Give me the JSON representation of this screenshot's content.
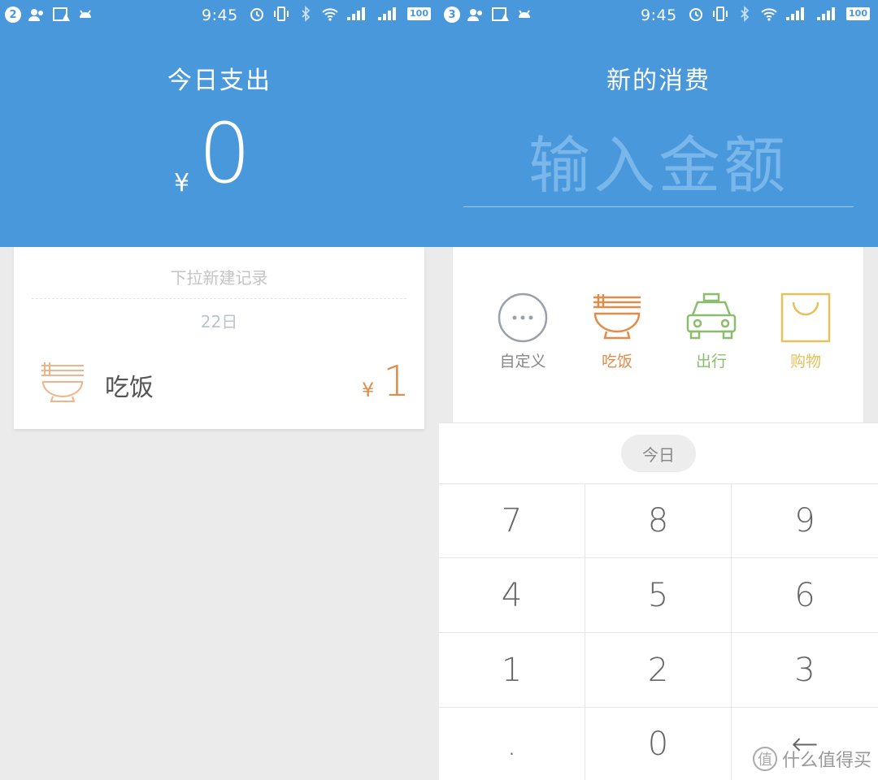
{
  "left": {
    "status": {
      "badge": "2",
      "time": "9:45",
      "battery": "100"
    },
    "header": {
      "title": "今日支出",
      "currency": "¥",
      "amount": "0"
    },
    "list": {
      "pull_hint": "下拉新建记录",
      "date": "22日",
      "record": {
        "name": "吃饭",
        "currency": "¥",
        "amount": "1",
        "icon": "bowl-icon"
      }
    }
  },
  "right": {
    "status": {
      "badge": "3",
      "time": "9:45",
      "battery": "100"
    },
    "header": {
      "title": "新的消费",
      "placeholder": "输入金额"
    },
    "categories": [
      {
        "label": "自定义",
        "icon": "more-icon",
        "color": "#9aa0aa"
      },
      {
        "label": "吃饭",
        "icon": "bowl-icon",
        "color": "#e28c4a"
      },
      {
        "label": "出行",
        "icon": "taxi-icon",
        "color": "#8abd6e"
      },
      {
        "label": "购物",
        "icon": "bag-icon",
        "color": "#e8c05a"
      }
    ],
    "date_chip": "今日",
    "keys": [
      "7",
      "8",
      "9",
      "4",
      "5",
      "6",
      "1",
      "2",
      "3",
      ".",
      "0",
      "←"
    ]
  },
  "watermark": {
    "text": "什么值得买",
    "badge": "值"
  },
  "colors": {
    "header_blue": "#4a98dc",
    "accent_orange": "#e28c4a"
  }
}
